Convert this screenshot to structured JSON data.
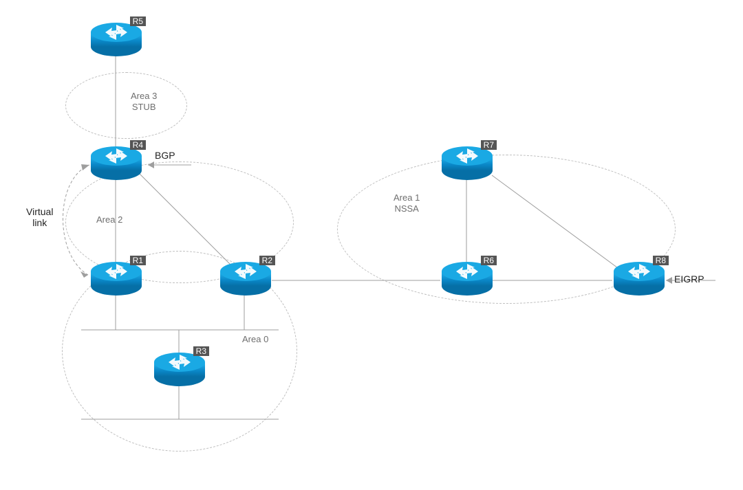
{
  "routers": {
    "R1": {
      "label": "R1"
    },
    "R2": {
      "label": "R2"
    },
    "R3": {
      "label": "R3"
    },
    "R4": {
      "label": "R4"
    },
    "R5": {
      "label": "R5"
    },
    "R6": {
      "label": "R6"
    },
    "R7": {
      "label": "R7"
    },
    "R8": {
      "label": "R8"
    }
  },
  "areas": {
    "area0": {
      "label": "Area 0"
    },
    "area1": {
      "label": "Area 1\nNSSA"
    },
    "area2": {
      "label": "Area 2"
    },
    "area3": {
      "label": "Area 3\nSTUB"
    }
  },
  "annotations": {
    "virtual_link": "Virtual\nlink",
    "bgp": "BGP",
    "eigrp": "EIGRP"
  }
}
